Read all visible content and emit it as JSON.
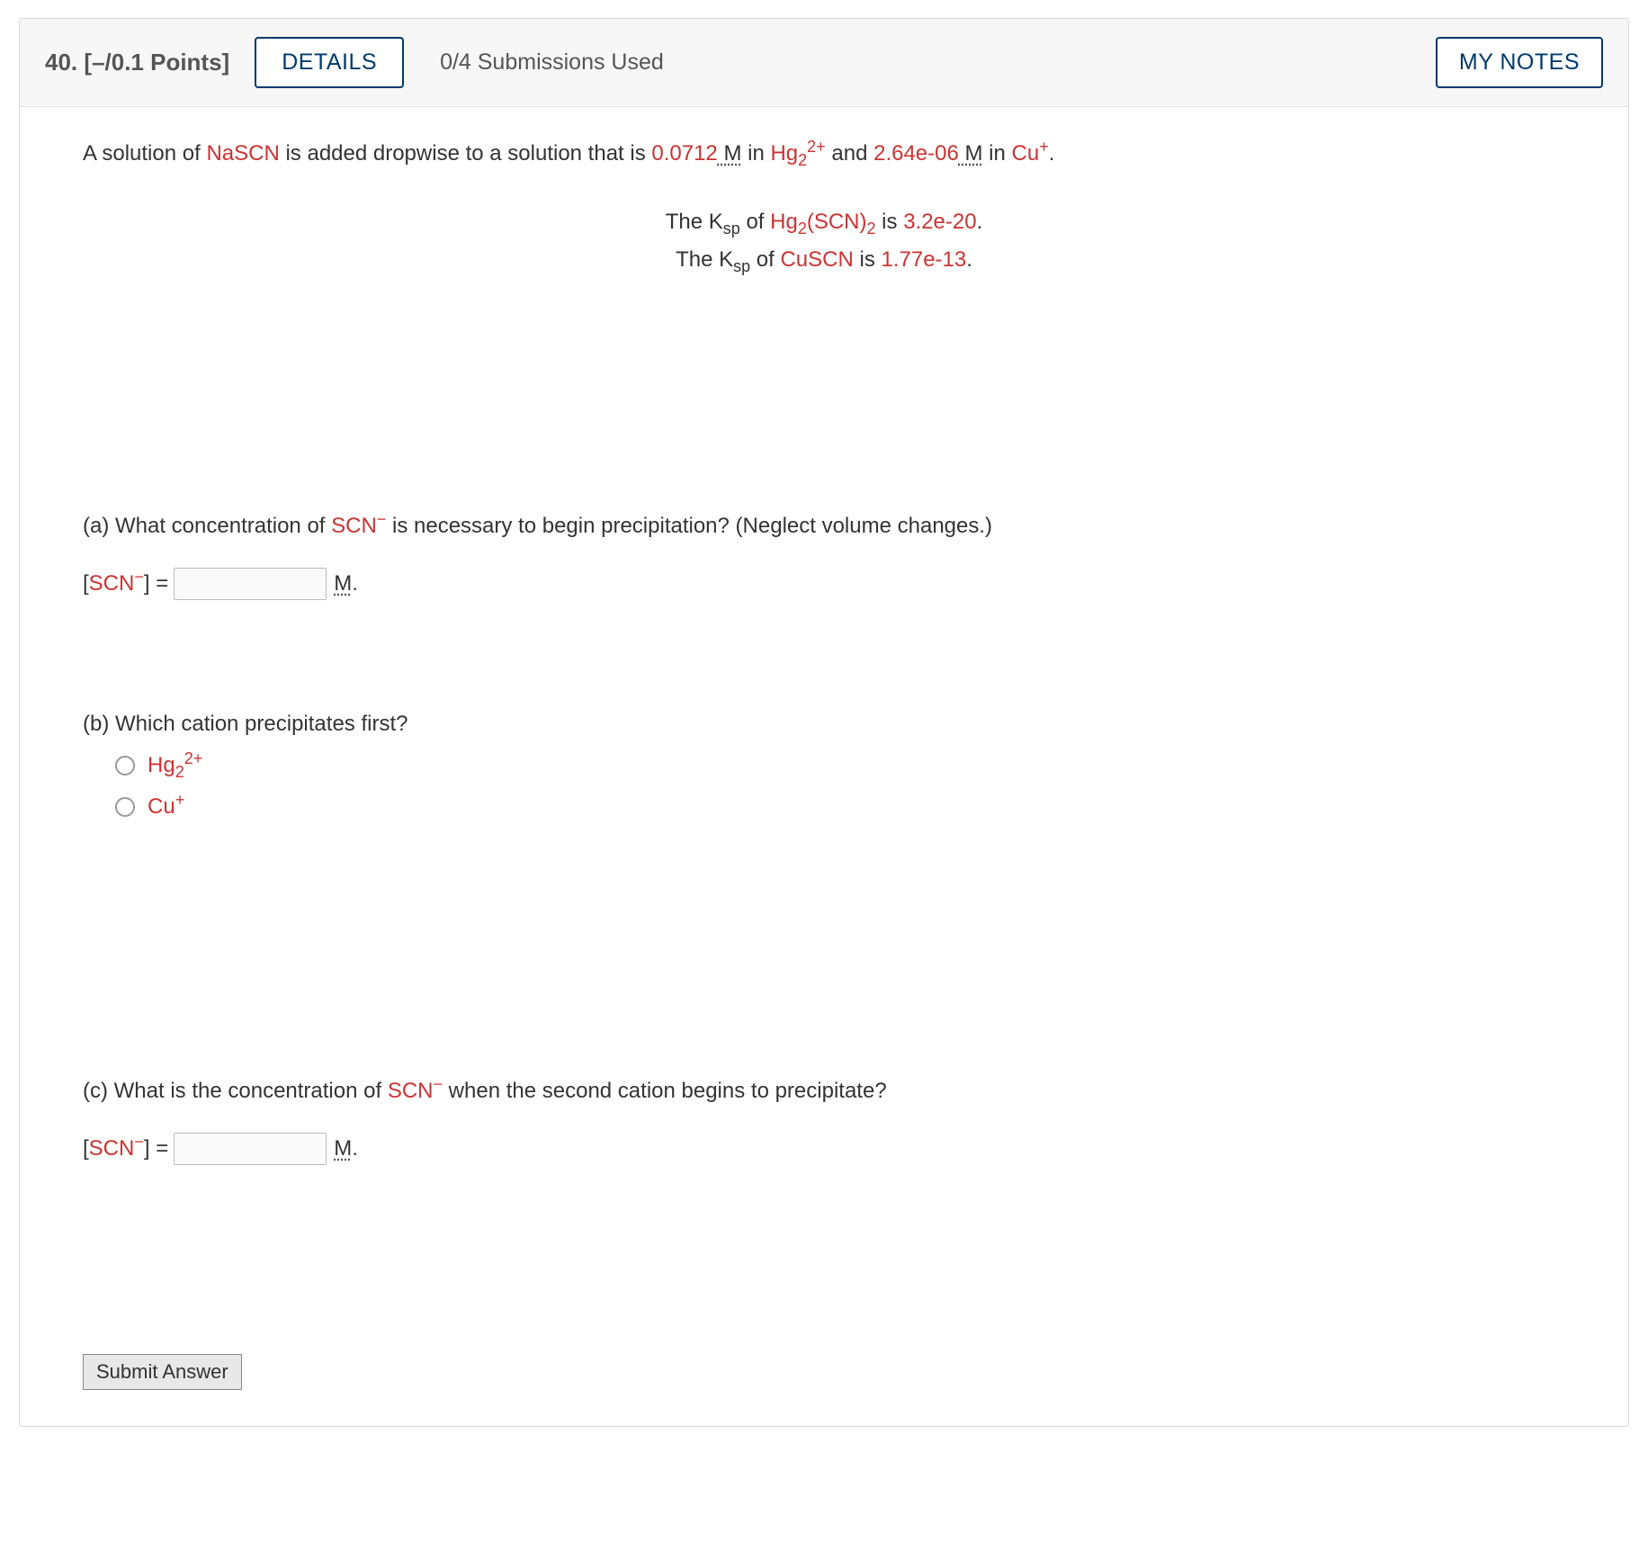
{
  "header": {
    "number": "40.",
    "points": "[–/0.1 Points]",
    "details_label": "DETAILS",
    "submissions": "0/4 Submissions Used",
    "my_notes_label": "MY NOTES"
  },
  "intro": {
    "prefix": "A solution of ",
    "reagent": "NaSCN",
    "mid1": " is added dropwise to a solution that is ",
    "conc1": "0.0712",
    "m1": " M",
    "in1": " in ",
    "species1_a": "Hg",
    "species1_sub": "2",
    "species1_sup": "2+",
    "and": " and ",
    "conc2": "2.64e-06",
    "m2": " M",
    "in2": " in ",
    "species2_a": "Cu",
    "species2_sup": "+",
    "end": "."
  },
  "ksp": {
    "line1_pre": "The K",
    "line1_sps": "sp",
    "line1_of": " of ",
    "line1_comp_a": "Hg",
    "line1_comp_sub1": "2",
    "line1_comp_mid": "(SCN)",
    "line1_comp_sub2": "2",
    "line1_is": " is ",
    "line1_val": "3.2e-20",
    "line1_end": ".",
    "line2_pre": "The K",
    "line2_sps": "sp",
    "line2_of": " of ",
    "line2_comp": "CuSCN",
    "line2_is": " is ",
    "line2_val": "1.77e-13",
    "line2_end": "."
  },
  "part_a": {
    "q_pre": "(a) What concentration of ",
    "scn": "SCN",
    "scn_sup": "−",
    "q_post": " is necessary to begin precipitation? (Neglect volume changes.)",
    "label_open": "[",
    "label_scn": "SCN",
    "label_sup": "−",
    "label_close_eq": "] = ",
    "unit": "M",
    "unit_post": "."
  },
  "part_b": {
    "q": "(b) Which cation precipitates first?",
    "opt1_a": "Hg",
    "opt1_sub": "2",
    "opt1_sup": "2+",
    "opt2_a": "Cu",
    "opt2_sup": "+"
  },
  "part_c": {
    "q_pre": "(c) What is the concentration of ",
    "scn": "SCN",
    "scn_sup": "−",
    "q_post": " when the second cation begins to precipitate?",
    "label_open": "[",
    "label_scn": "SCN",
    "label_sup": "−",
    "label_close_eq": "] = ",
    "unit": "M",
    "unit_post": "."
  },
  "submit_label": "Submit Answer"
}
